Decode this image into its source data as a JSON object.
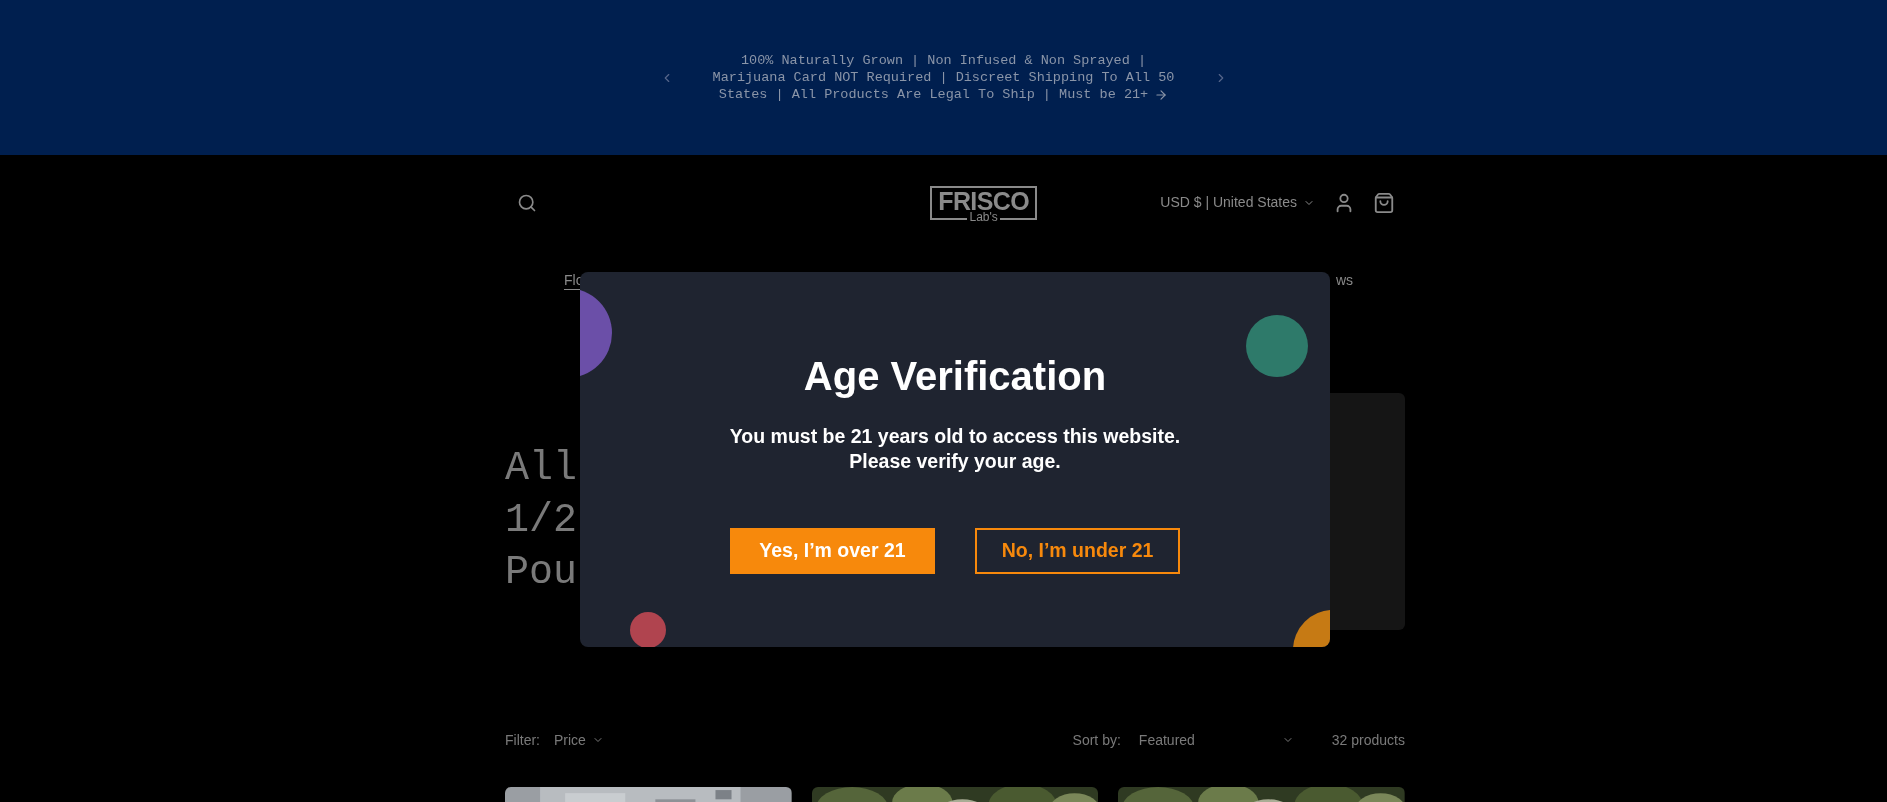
{
  "announcement": {
    "lines": [
      "100% Naturally Grown | Non Infused & Non Sprayed |",
      "Marijuana Card NOT Required | Discreet Shipping To All 50",
      "States | All Products Are Legal To Ship | Must be 21+"
    ]
  },
  "header": {
    "logo": {
      "word": "FRISCO",
      "sub": "Lab's"
    },
    "currency": "USD $ | United States"
  },
  "nav": [
    {
      "label": "Flo",
      "selected": true
    },
    {
      "label": "ws",
      "selected": false
    }
  ],
  "hero": {
    "title_lines": [
      "All",
      "1/2",
      "Pou"
    ]
  },
  "modal": {
    "title": "Age Verification",
    "message": [
      "You must be 21 years old to access this website.",
      "Please verify your age."
    ],
    "buttons": [
      {
        "label": "Yes, I’m over 21",
        "kind": "primary"
      },
      {
        "label": "No, I’m under 21",
        "kind": "outline"
      }
    ]
  },
  "filter": {
    "label": "Filter:",
    "price": "Price",
    "sort_label": "Sort by:",
    "sort_value": "Featured",
    "count": "32 products"
  }
}
